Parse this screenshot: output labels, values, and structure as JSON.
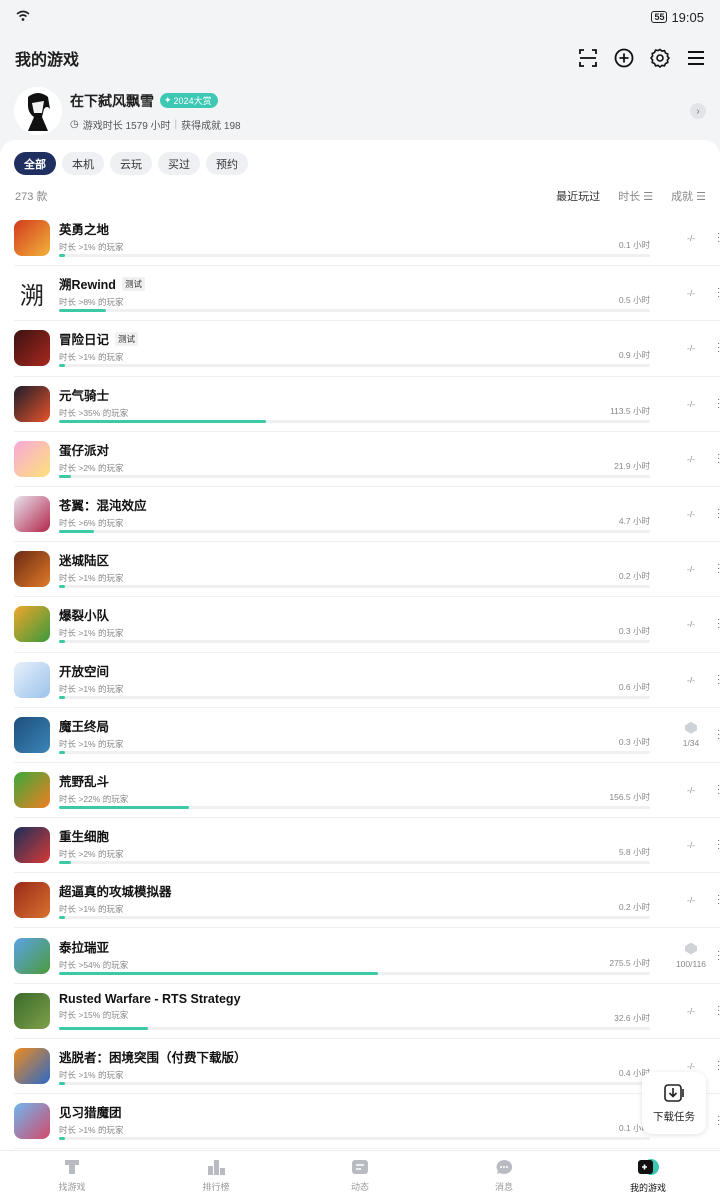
{
  "status": {
    "battery": "55",
    "time": "19:05"
  },
  "header": {
    "title": "我的游戏"
  },
  "profile": {
    "name": "在下弑风飘雪",
    "badge": "2024大赏",
    "play_time": "游戏时长 1579 小时",
    "achievements": "获得成就 198"
  },
  "filters": [
    "全部",
    "本机",
    "云玩",
    "买过",
    "预约"
  ],
  "sort": {
    "count": "273 款",
    "recent": "最近玩过",
    "duration": "时长",
    "achievement": "成就"
  },
  "games": [
    {
      "name": "英勇之地",
      "tag": "",
      "sub": "时长 >1% 的玩家",
      "hours": "0.1 小时",
      "ach": "-/-",
      "pct": 1,
      "c1": "#d23b1e",
      "c2": "#f2b33a"
    },
    {
      "name": "溯Rewind",
      "tag": "测试",
      "sub": "时长 >8% 的玩家",
      "hours": "0.5 小时",
      "ach": "-/-",
      "pct": 8,
      "c1": "#ffffff",
      "c2": "#ffffff"
    },
    {
      "name": "冒险日记",
      "tag": "测试",
      "sub": "时长 >1% 的玩家",
      "hours": "0.9 小时",
      "ach": "-/-",
      "pct": 1,
      "c1": "#3b1212",
      "c2": "#a8281e"
    },
    {
      "name": "元气骑士",
      "tag": "",
      "sub": "时长 >35% 的玩家",
      "hours": "113.5 小时",
      "ach": "-/-",
      "pct": 35,
      "c1": "#1c1c2a",
      "c2": "#e8532b"
    },
    {
      "name": "蛋仔派对",
      "tag": "",
      "sub": "时长 >2% 的玩家",
      "hours": "21.9 小时",
      "ach": "-/-",
      "pct": 2,
      "c1": "#f7a8d8",
      "c2": "#fde27a"
    },
    {
      "name": "苍翼：混沌效应",
      "tag": "",
      "sub": "时长 >6% 的玩家",
      "hours": "4.7 小时",
      "ach": "-/-",
      "pct": 6,
      "c1": "#e9e4f0",
      "c2": "#b2264a"
    },
    {
      "name": "迷城陆区",
      "tag": "",
      "sub": "时长 >1% 的玩家",
      "hours": "0.2 小时",
      "ach": "-/-",
      "pct": 1,
      "c1": "#6b2a12",
      "c2": "#e07a2a"
    },
    {
      "name": "爆裂小队",
      "tag": "",
      "sub": "时长 >1% 的玩家",
      "hours": "0.3 小时",
      "ach": "-/-",
      "pct": 1,
      "c1": "#f0a62a",
      "c2": "#3a9a3c"
    },
    {
      "name": "开放空间",
      "tag": "",
      "sub": "时长 >1% 的玩家",
      "hours": "0.6 小时",
      "ach": "-/-",
      "pct": 1,
      "c1": "#e7f0fb",
      "c2": "#9bc3ea"
    },
    {
      "name": "魔王终局",
      "tag": "",
      "sub": "时长 >1% 的玩家",
      "hours": "0.3 小时",
      "ach": "1/34",
      "pct": 1,
      "c1": "#1e4e7a",
      "c2": "#3b86b8"
    },
    {
      "name": "荒野乱斗",
      "tag": "",
      "sub": "时长 >22% 的玩家",
      "hours": "156.5 小时",
      "ach": "-/-",
      "pct": 22,
      "c1": "#3aa83a",
      "c2": "#f07f22"
    },
    {
      "name": "重生细胞",
      "tag": "",
      "sub": "时长 >2% 的玩家",
      "hours": "5.8 小时",
      "ach": "-/-",
      "pct": 2,
      "c1": "#1a2f5a",
      "c2": "#d63a36"
    },
    {
      "name": "超逼真的攻城模拟器",
      "tag": "",
      "sub": "时长 >1% 的玩家",
      "hours": "0.2 小时",
      "ach": "-/-",
      "pct": 1,
      "c1": "#9a2a1a",
      "c2": "#d8722e"
    },
    {
      "name": "泰拉瑞亚",
      "tag": "",
      "sub": "时长 >54% 的玩家",
      "hours": "275.5 小时",
      "ach": "100/116",
      "pct": 54,
      "c1": "#5aa3e8",
      "c2": "#4e9a3a"
    },
    {
      "name": "Rusted Warfare - RTS Strategy",
      "tag": "",
      "sub": "时长 >15% 的玩家",
      "hours": "32.6 小时",
      "ach": "-/-",
      "pct": 15,
      "c1": "#3a6a2a",
      "c2": "#7fa04a"
    },
    {
      "name": "逃脱者：困境突围（付费下载版）",
      "tag": "",
      "sub": "时长 >1% 的玩家",
      "hours": "0.4 小时",
      "ach": "-/-",
      "pct": 1,
      "c1": "#f08a1e",
      "c2": "#2a6ac8"
    },
    {
      "name": "见习猎魔团",
      "tag": "",
      "sub": "时长 >1% 的玩家",
      "hours": "0.1 小时",
      "ach": "",
      "pct": 1,
      "c1": "#6fb6f0",
      "c2": "#d24a6a"
    }
  ],
  "download_task": "下载任务",
  "nav": [
    "找游戏",
    "排行榜",
    "动态",
    "消息",
    "我的游戏"
  ]
}
